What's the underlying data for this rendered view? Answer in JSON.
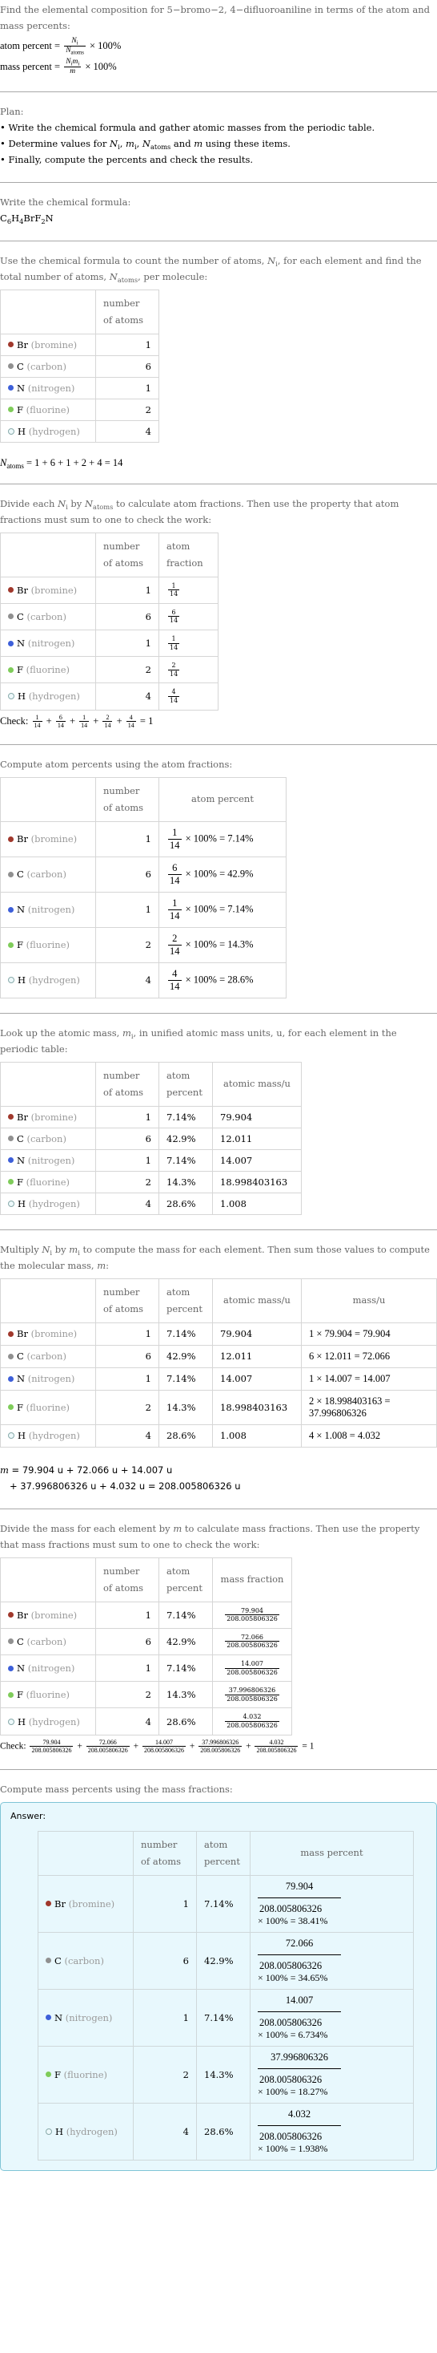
{
  "intro": {
    "text": "Find the elemental composition for 5−bromo−2, 4−difluoroaniline in terms of the atom and mass percents:",
    "atom_percent_label": "atom percent = ",
    "atom_percent_num": "N",
    "atom_percent_num_sub": "i",
    "atom_percent_den": "N",
    "atom_percent_den_sub": "atoms",
    "times100": "× 100%",
    "mass_percent_label": "mass percent = ",
    "mass_percent_num": "N",
    "mass_percent_num_sub": "i",
    "mass_percent_num2": "m",
    "mass_percent_num2_sub": "i",
    "mass_percent_den": "m"
  },
  "plan": {
    "title": "Plan:",
    "bullets": [
      "Write the chemical formula and gather atomic masses from the periodic table.",
      "Determine values for N_i, m_i, N_atoms and m using these items.",
      "Finally, compute the percents and check the results."
    ],
    "bullet2_parts": {
      "pre": "Determine values for ",
      "N": "N",
      "Nsub": "i",
      "m": "m",
      "msub": "i",
      "Na": "N",
      "Nasub": "atoms",
      "and": " and ",
      "m2": "m",
      "post": " using these items."
    }
  },
  "formula": {
    "title": "Write the chemical formula:",
    "parts": [
      "C",
      "6",
      "H",
      "4",
      "BrF",
      "2",
      "N"
    ]
  },
  "count": {
    "text_pre": "Use the chemical formula to count the number of atoms, ",
    "text_mid": ", for each element and find the total number of atoms, ",
    "text_post": ", per molecule:",
    "header": [
      "",
      "number of atoms"
    ],
    "total_label": "N",
    "total_sub": "atoms",
    "total_expr": " = 1 + 6 + 1 + 2 + 4 = 14"
  },
  "elements": [
    {
      "symbol": "Br",
      "name": "(bromine)",
      "color": "#a0382c",
      "count": "1",
      "frac_num": "1",
      "frac_den": "14",
      "atom_pct": "7.14%",
      "atomic_mass": "79.904",
      "mass_expr": "1 × 79.904 = 79.904",
      "mass": "79.904",
      "mass_pct": "38.41%"
    },
    {
      "symbol": "C",
      "name": "(carbon)",
      "color": "#909090",
      "count": "6",
      "frac_num": "6",
      "frac_den": "14",
      "atom_pct": "42.9%",
      "atomic_mass": "12.011",
      "mass_expr": "6 × 12.011 = 72.066",
      "mass": "72.066",
      "mass_pct": "34.65%"
    },
    {
      "symbol": "N",
      "name": "(nitrogen)",
      "color": "#3d5fd9",
      "count": "1",
      "frac_num": "1",
      "frac_den": "14",
      "atom_pct": "7.14%",
      "atomic_mass": "14.007",
      "mass_expr": "1 × 14.007 = 14.007",
      "mass": "14.007",
      "mass_pct": "6.734%"
    },
    {
      "symbol": "F",
      "name": "(fluorine)",
      "color": "#7fcc5a",
      "count": "2",
      "frac_num": "2",
      "frac_den": "14",
      "atom_pct": "14.3%",
      "atomic_mass": "18.998403163",
      "mass_expr": "2 × 18.998403163 = 37.996806326",
      "mass": "37.996806326",
      "mass_pct": "18.27%"
    },
    {
      "symbol": "H",
      "name": "(hydrogen)",
      "color": "#eef9fb",
      "count": "4",
      "frac_num": "4",
      "frac_den": "14",
      "atom_pct": "28.6%",
      "atomic_mass": "1.008",
      "mass_expr": "4 × 1.008 = 4.032",
      "mass": "4.032",
      "mass_pct": "1.938%"
    }
  ],
  "fractions": {
    "text": "Divide each N_i by N_atoms to calculate atom fractions. Then use the property that atom fractions must sum to one to check the work:",
    "text_pre": "Divide each ",
    "text_by": " by ",
    "text_post": " to calculate atom fractions. Then use the property that atom fractions must sum to one to check the work:",
    "header": [
      "",
      "number of atoms",
      "atom fraction"
    ],
    "check_label": "Check: ",
    "check_result": " = 1"
  },
  "atom_percents": {
    "text": "Compute atom percents using the atom fractions:",
    "header": [
      "",
      "number of atoms",
      "atom percent"
    ],
    "times100": " × 100% = "
  },
  "masses": {
    "text_pre": "Look up the atomic mass, ",
    "text_post": ", in unified atomic mass units, u, for each element in the periodic table:",
    "header": [
      "",
      "number of atoms",
      "atom percent",
      "atomic mass/u"
    ]
  },
  "molecular_mass": {
    "text_pre": "Multiply ",
    "text_by": " by ",
    "text_mid": " to compute the mass for each element. Then sum those values to compute the molecular mass, ",
    "text_post": ":",
    "header": [
      "",
      "number of atoms",
      "atom percent",
      "atomic mass/u",
      "mass/u"
    ],
    "sum_line1": " = 79.904 u + 72.066 u + 14.007 u",
    "sum_line2": "+ 37.996806326 u + 4.032 u = 208.005806326 u",
    "total": "208.005806326"
  },
  "mass_fractions": {
    "text_pre": "Divide the mass for each element by ",
    "text_post": " to calculate mass fractions. Then use the property that mass fractions must sum to one to check the work:",
    "header": [
      "",
      "number of atoms",
      "atom percent",
      "mass fraction"
    ],
    "check_label": "Check: ",
    "check_result": " = 1"
  },
  "mass_percents": {
    "text": "Compute mass percents using the mass fractions:",
    "answer_label": "Answer:",
    "header": [
      "",
      "number of atoms",
      "atom percent",
      "mass percent"
    ],
    "times100": "× 100% = "
  },
  "symbols": {
    "N": "N",
    "i": "i",
    "m": "m",
    "atoms": "atoms",
    "plus": " + "
  }
}
